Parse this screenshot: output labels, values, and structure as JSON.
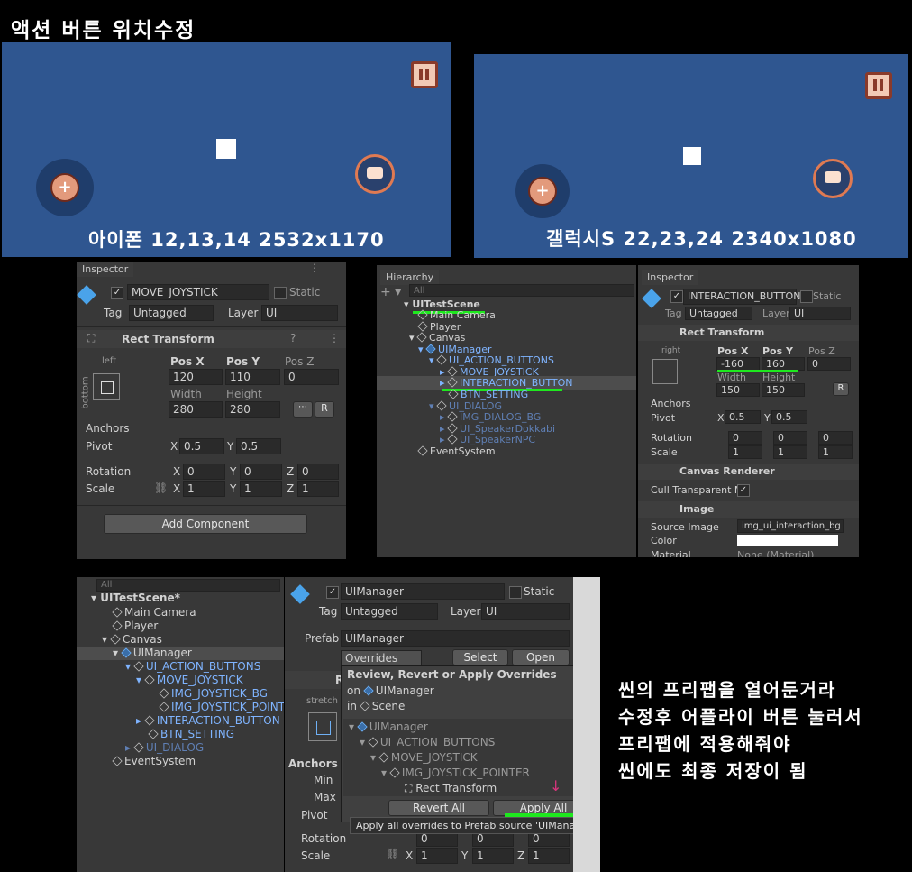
{
  "title": "액션 버튼 위치수정",
  "screens": {
    "left_caption": "아이폰 12,13,14 2532x1170",
    "right_caption": "갤럭시S 22,23,24 2340x1080"
  },
  "inspector1": {
    "tab": "Inspector",
    "object_name": "MOVE_JOYSTICK",
    "static": "Static",
    "tag_label": "Tag",
    "tag_value": "Untagged",
    "layer_label": "Layer",
    "layer_value": "UI",
    "component": "Rect Transform",
    "anchor_h": "left",
    "anchor_v": "bottom",
    "posx_label": "Pos X",
    "posy_label": "Pos Y",
    "posz_label": "Pos Z",
    "posx": "120",
    "posy": "110",
    "posz": "0",
    "width_label": "Width",
    "height_label": "Height",
    "width": "280",
    "height": "280",
    "anchors": "Anchors",
    "pivot": "Pivot",
    "pivot_x": "0.5",
    "pivot_y": "0.5",
    "rotation": "Rotation",
    "rot_x": "0",
    "rot_y": "0",
    "rot_z": "0",
    "scale": "Scale",
    "scale_x": "1",
    "scale_y": "1",
    "scale_z": "1",
    "add_component": "Add Component",
    "r_btn": "R",
    "x": "X",
    "y": "Y",
    "z": "Z"
  },
  "hierarchy1": {
    "tab": "Hierarchy",
    "search": "All",
    "scene": "UITestScene",
    "items": [
      "Main Camera",
      "Player",
      "Canvas",
      "UIManager",
      "UI_ACTION_BUTTONS",
      "MOVE_JOYSTICK",
      "INTERACTION_BUTTON",
      "BTN_SETTING",
      "UI_DIALOG",
      "IMG_DIALOG_BG",
      "UI_SpeakerDokkabi",
      "UI_SpeakerNPC",
      "EventSystem"
    ]
  },
  "inspector2": {
    "tab": "Inspector",
    "object_name": "INTERACTION_BUTTON",
    "static": "Static",
    "tag_label": "Tag",
    "tag_value": "Untagged",
    "layer_label": "Layer",
    "layer_value": "UI",
    "component": "Rect Transform",
    "anchor_h": "right",
    "anchor_v": "bottom",
    "posx_label": "Pos X",
    "posy_label": "Pos Y",
    "posz_label": "Pos Z",
    "posx": "-160",
    "posy": "160",
    "posz": "0",
    "width_label": "Width",
    "height_label": "Height",
    "width": "150",
    "height": "150",
    "anchors": "Anchors",
    "pivot": "Pivot",
    "pivot_x": "0.5",
    "pivot_y": "0.5",
    "rotation": "Rotation",
    "rot_x": "0",
    "rot_y": "0",
    "rot_z": "0",
    "scale": "Scale",
    "scale_x": "1",
    "scale_y": "1",
    "scale_z": "1",
    "canvas_renderer": "Canvas Renderer",
    "cull": "Cull Transparent Me",
    "image": "Image",
    "source_image_label": "Source Image",
    "source_image": "img_ui_interaction_bg",
    "color_label": "Color",
    "material_label": "Material",
    "material": "None (Material)",
    "r_btn": "R",
    "x": "X",
    "y": "Y",
    "z": "Z"
  },
  "hierarchy2": {
    "search": "All",
    "scene": "UITestScene*",
    "items": [
      "Main Camera",
      "Player",
      "Canvas",
      "UIManager",
      "UI_ACTION_BUTTONS",
      "MOVE_JOYSTICK",
      "IMG_JOYSTICK_BG",
      "IMG_JOYSTICK_POINTE",
      "INTERACTION_BUTTON",
      "BTN_SETTING",
      "UI_DIALOG",
      "EventSystem"
    ]
  },
  "inspector3": {
    "object_name": "UIManager",
    "static": "Static",
    "tag_label": "Tag",
    "tag_value": "Untagged",
    "layer_label": "Layer",
    "layer_value": "UI",
    "prefab_label": "Prefab",
    "prefab_value": "UIManager",
    "overrides": "Overrides",
    "select": "Select",
    "open": "Open",
    "rect_partial": "R",
    "stretch": "stretch",
    "anchors": "Anchors",
    "min": "Min",
    "max": "Max",
    "pivot": "Pivot",
    "rotation": "Rotation",
    "rot_x": "0",
    "rot_y": "0",
    "rot_z": "0",
    "scale": "Scale",
    "scale_x": "1",
    "scale_y": "1",
    "scale_z": "1",
    "x": "X",
    "y": "Y",
    "z": "Z"
  },
  "overrides_popup": {
    "heading": "Review, Revert or Apply Overrides",
    "on_label": "on",
    "on_value": "UIManager",
    "in_label": "in",
    "in_value": "Scene",
    "tree": [
      "UIManager",
      "UI_ACTION_BUTTONS",
      "MOVE_JOYSTICK",
      "IMG_JOYSTICK_POINTER",
      "Rect Transform"
    ],
    "revert_all": "Revert All",
    "apply_all": "Apply All",
    "tooltip": "Apply all overrides to Prefab source 'UIManager'."
  },
  "note": {
    "line1": "씬의 프리팹을 열어둔거라",
    "line2": "수정후 어플라이 버튼 눌러서",
    "line3": "프리팹에 적용해줘야",
    "line4": "씬에도 최종 저장이 됨"
  },
  "colors": {
    "screen_bg": "#2f5690",
    "highlight": "#1ee81e",
    "unity_panel": "#383838"
  }
}
